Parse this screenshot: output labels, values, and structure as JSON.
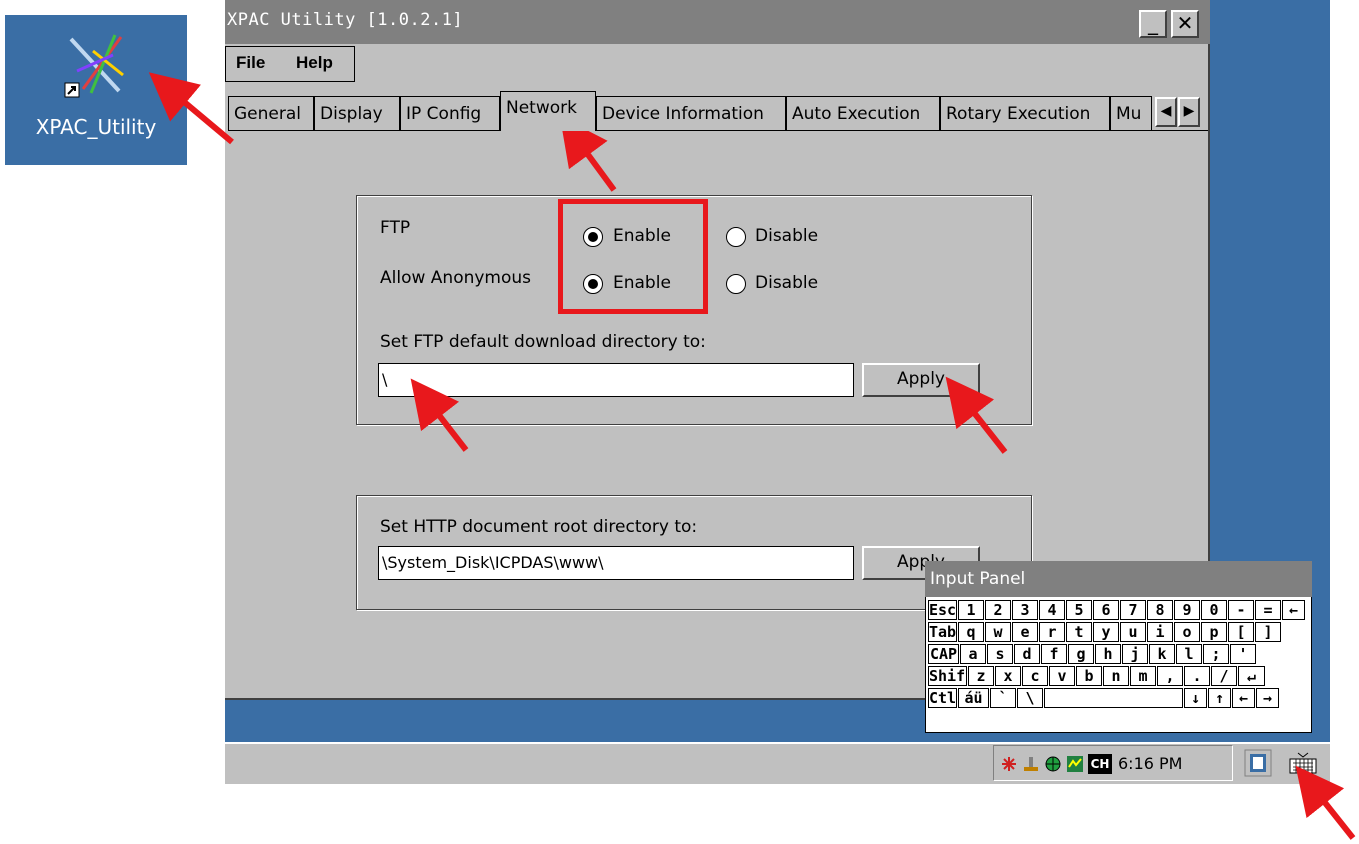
{
  "desktop": {
    "shortcut_label": "XPAC_Utility"
  },
  "window": {
    "title": "XPAC Utility [1.0.2.1]",
    "minimize": "_",
    "close": "✕"
  },
  "menu": {
    "file": "File",
    "help": "Help"
  },
  "tabs": [
    {
      "label": "General"
    },
    {
      "label": "Display"
    },
    {
      "label": "IP Config"
    },
    {
      "label": "Network",
      "active": true
    },
    {
      "label": "Device Information"
    },
    {
      "label": "Auto Execution"
    },
    {
      "label": "Rotary Execution"
    },
    {
      "label": "Mu"
    }
  ],
  "tab_scroll": {
    "left": "◀",
    "right": "▶"
  },
  "ftp": {
    "ftp_label": "FTP",
    "anon_label": "Allow Anonymous",
    "enable_label": "Enable",
    "disable_label": "Disable",
    "ftp_selected": "Enable",
    "anon_selected": "Enable",
    "dir_label": "Set FTP default download directory to:",
    "dir_value": "\\",
    "apply_label": "Apply"
  },
  "http": {
    "dir_label": "Set HTTP document root directory to:",
    "dir_value": "\\System_Disk\\ICPDAS\\www\\",
    "apply_label": "Apply"
  },
  "input_panel": {
    "title": "Input Panel",
    "rows": [
      [
        "Esc",
        "1",
        "2",
        "3",
        "4",
        "5",
        "6",
        "7",
        "8",
        "9",
        "0",
        "-",
        "=",
        "←"
      ],
      [
        "Tab",
        "q",
        "w",
        "e",
        "r",
        "t",
        "y",
        "u",
        "i",
        "o",
        "p",
        "[",
        "]"
      ],
      [
        "CAP",
        "a",
        "s",
        "d",
        "f",
        "g",
        "h",
        "j",
        "k",
        "l",
        ";",
        "'"
      ],
      [
        "Shift",
        "z",
        "x",
        "c",
        "v",
        "b",
        "n",
        "m",
        ",",
        ".",
        "/",
        "↵"
      ],
      [
        "Ctl",
        "áü",
        "`",
        "\\",
        "",
        "↓",
        "↑",
        "←",
        "→"
      ]
    ]
  },
  "taskbar": {
    "clock": "6:16 PM",
    "lang": "CH"
  },
  "colors": {
    "desktop": "#3a6ea5",
    "window": "#c0c0c0",
    "titlebar": "#808080",
    "annotation": "#e8181c"
  }
}
